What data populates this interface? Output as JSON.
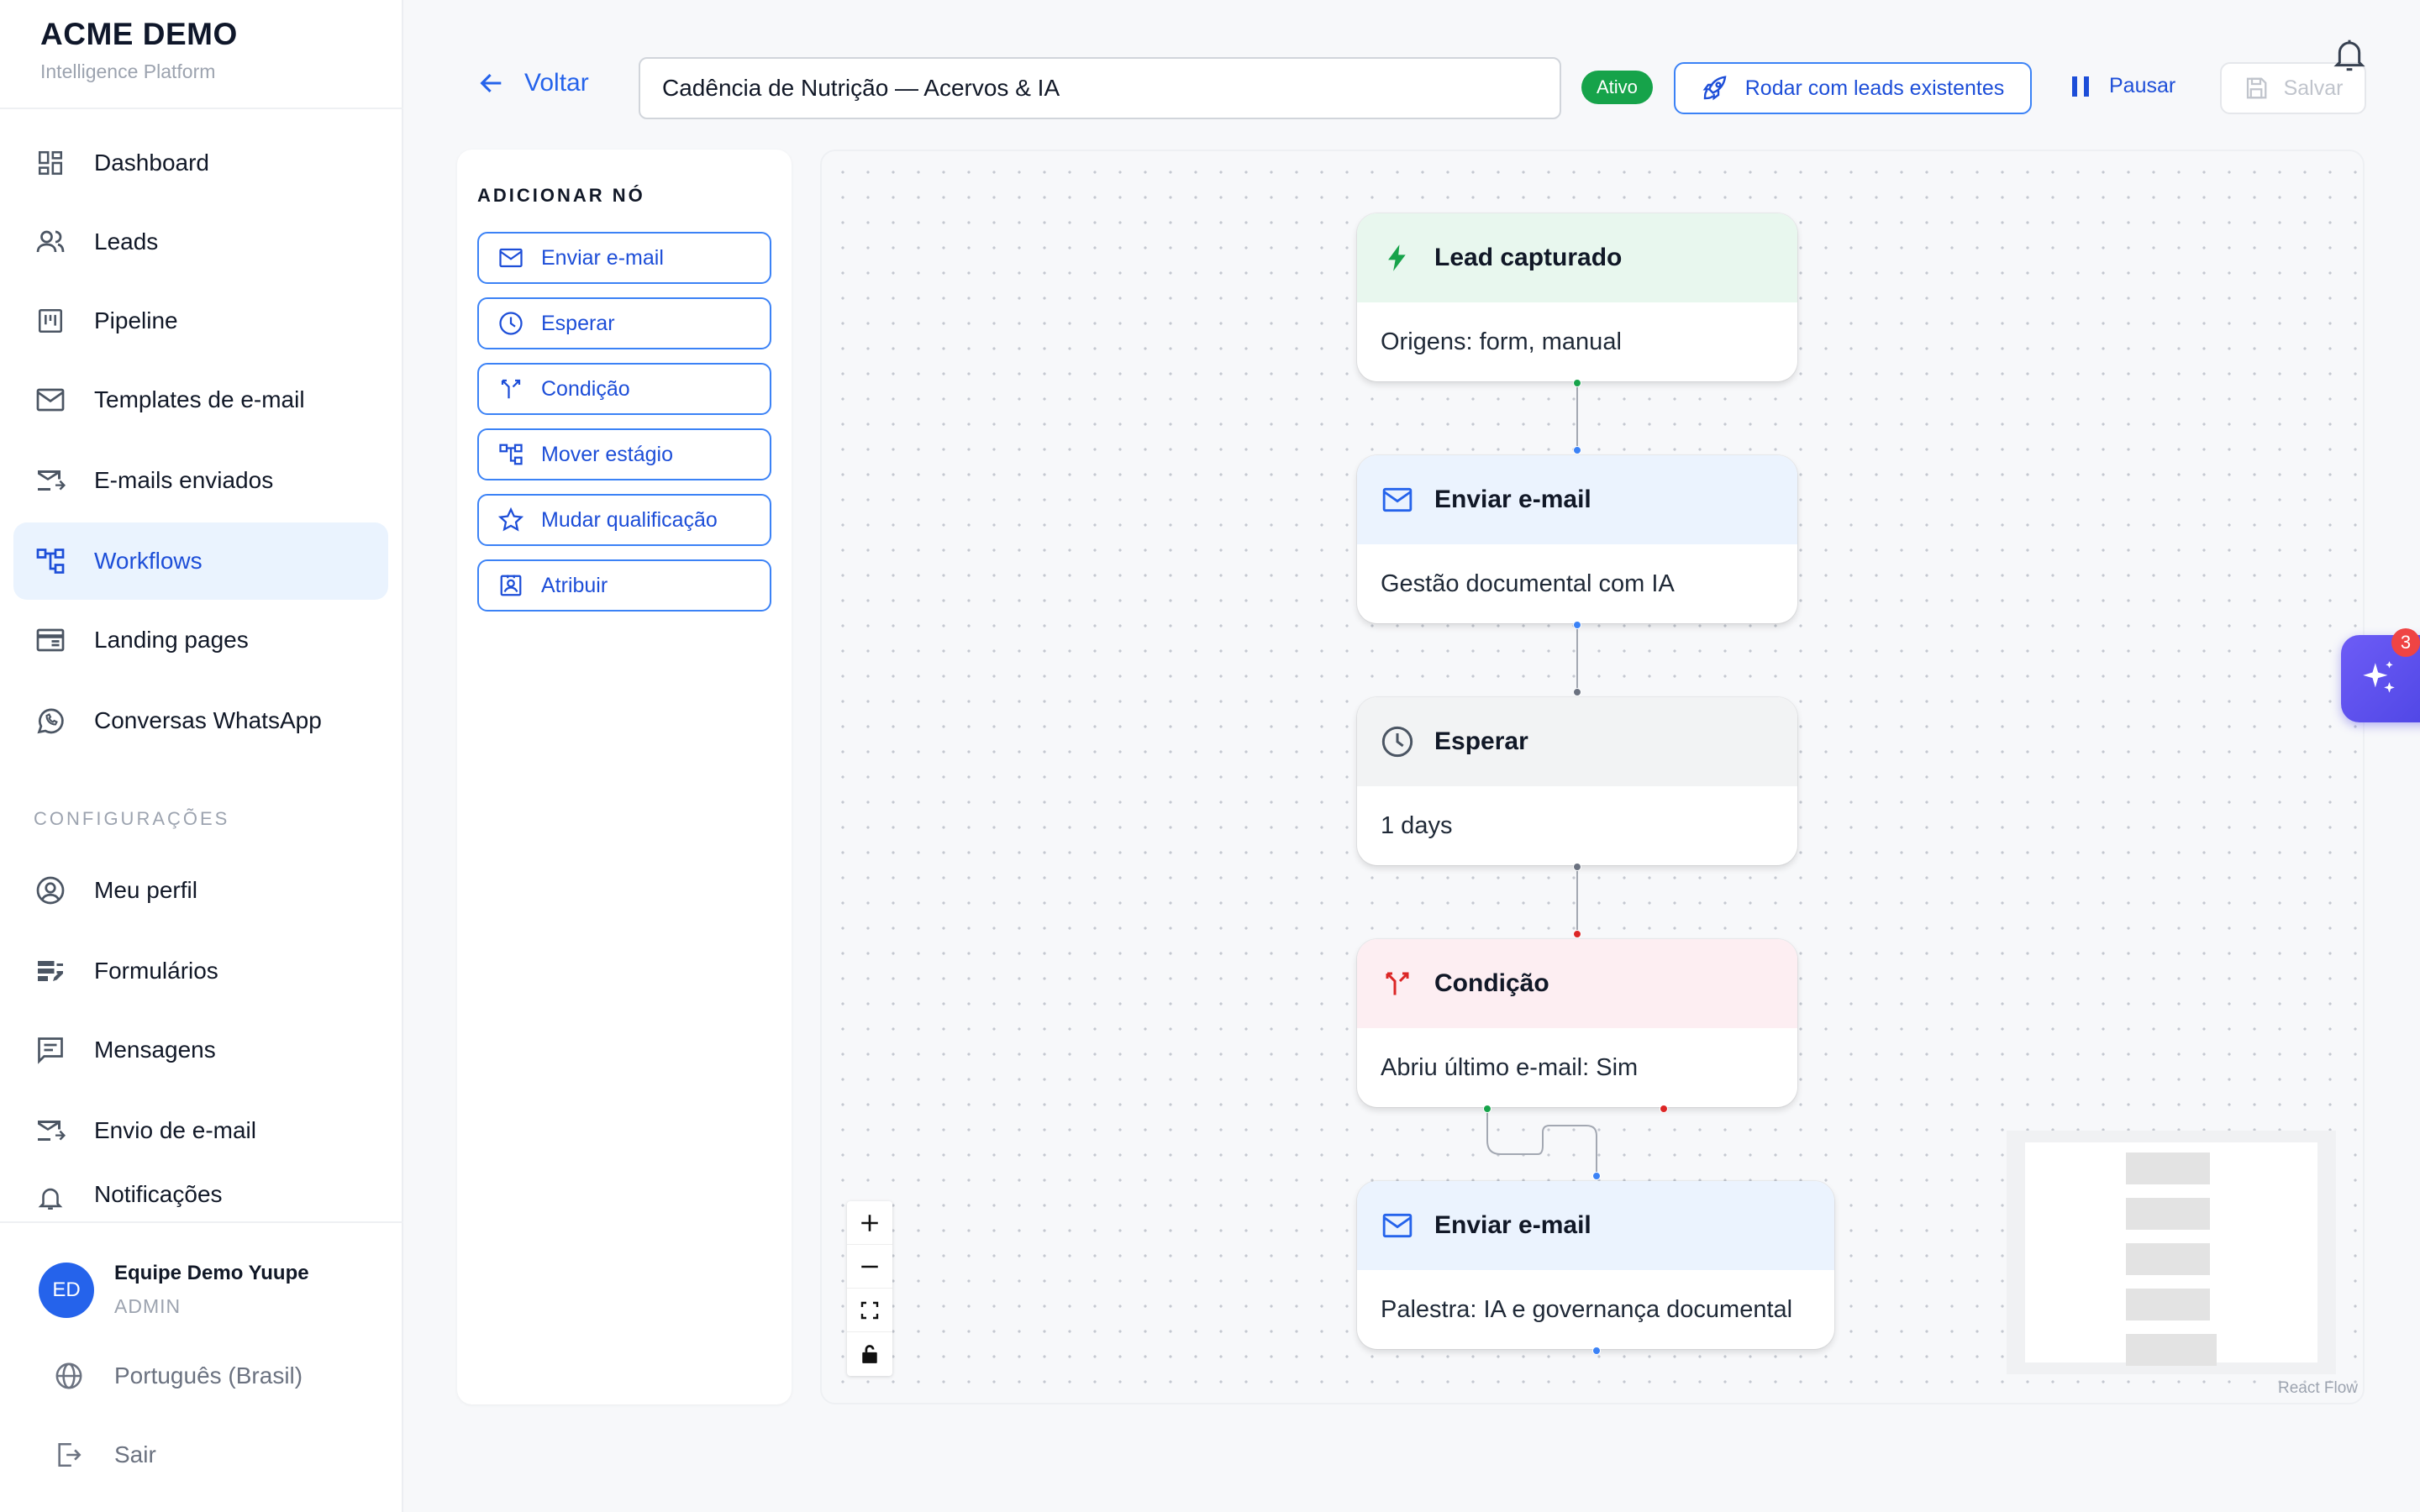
{
  "brand": {
    "name": "ACME DEMO",
    "subtitle": "Intelligence Platform"
  },
  "sidebar": {
    "items": [
      {
        "label": "Dashboard",
        "icon": "dashboard-icon"
      },
      {
        "label": "Leads",
        "icon": "users-icon"
      },
      {
        "label": "Pipeline",
        "icon": "kanban-icon"
      },
      {
        "label": "Templates de e-mail",
        "icon": "mail-icon"
      },
      {
        "label": "E-mails enviados",
        "icon": "mail-sent-icon"
      },
      {
        "label": "Workflows",
        "icon": "workflow-icon",
        "active": true
      },
      {
        "label": "Landing pages",
        "icon": "landing-icon"
      },
      {
        "label": "Conversas WhatsApp",
        "icon": "whatsapp-icon"
      }
    ],
    "config_section": "CONFIGURAÇÕES",
    "config_items": [
      {
        "label": "Meu perfil",
        "icon": "profile-icon"
      },
      {
        "label": "Formulários",
        "icon": "forms-icon"
      },
      {
        "label": "Mensagens",
        "icon": "message-icon"
      },
      {
        "label": "Envio de e-mail",
        "icon": "mail-send-icon"
      },
      {
        "label": "Notificações",
        "icon": "bell-icon"
      }
    ],
    "user": {
      "initials": "ED",
      "name": "Equipe Demo Yuupe",
      "role": "ADMIN"
    },
    "language": "Português (Brasil)",
    "logout": "Sair"
  },
  "topbar": {
    "back_label": "Voltar",
    "title_value": "Cadência de Nutrição — Acervos & IA",
    "status": "Ativo",
    "run_label": "Rodar com leads existentes",
    "pause_label": "Pausar",
    "save_label": "Salvar"
  },
  "palette": {
    "title": "ADICIONAR NÓ",
    "items": [
      {
        "label": "Enviar e-mail",
        "icon": "mail-icon"
      },
      {
        "label": "Esperar",
        "icon": "clock-icon"
      },
      {
        "label": "Condição",
        "icon": "branch-icon"
      },
      {
        "label": "Mover estágio",
        "icon": "workflow-icon"
      },
      {
        "label": "Mudar qualificação",
        "icon": "star-icon"
      },
      {
        "label": "Atribuir",
        "icon": "assign-icon"
      }
    ]
  },
  "nodes": [
    {
      "title": "Lead capturado",
      "body": "Origens: form, manual",
      "icon": "bolt-icon",
      "color": "#16a34a",
      "header_bg": "#e8f7ee"
    },
    {
      "title": "Enviar e-mail",
      "body": "Gestão documental com IA",
      "icon": "mail-icon",
      "color": "#2563eb",
      "header_bg": "#ebf3fe"
    },
    {
      "title": "Esperar",
      "body": "1 days",
      "icon": "clock-icon",
      "color": "#4b5563",
      "header_bg": "#f2f3f4"
    },
    {
      "title": "Condição",
      "body": "Abriu último e-mail: Sim",
      "icon": "branch-icon",
      "color": "#dc2626",
      "header_bg": "#fdeef2"
    },
    {
      "title": "Enviar e-mail",
      "body": "Palestra: IA e governança documental",
      "icon": "mail-icon",
      "color": "#2563eb",
      "header_bg": "#ebf3fe"
    }
  ],
  "reactflow_attribution": "React Flow",
  "assistant": {
    "badge_count": "3"
  },
  "colors": {
    "accent": "#2563eb",
    "active_nav_bg": "#eaf3fe",
    "success": "#16a34a",
    "danger": "#dc2626",
    "fab": "#5b50ee"
  }
}
